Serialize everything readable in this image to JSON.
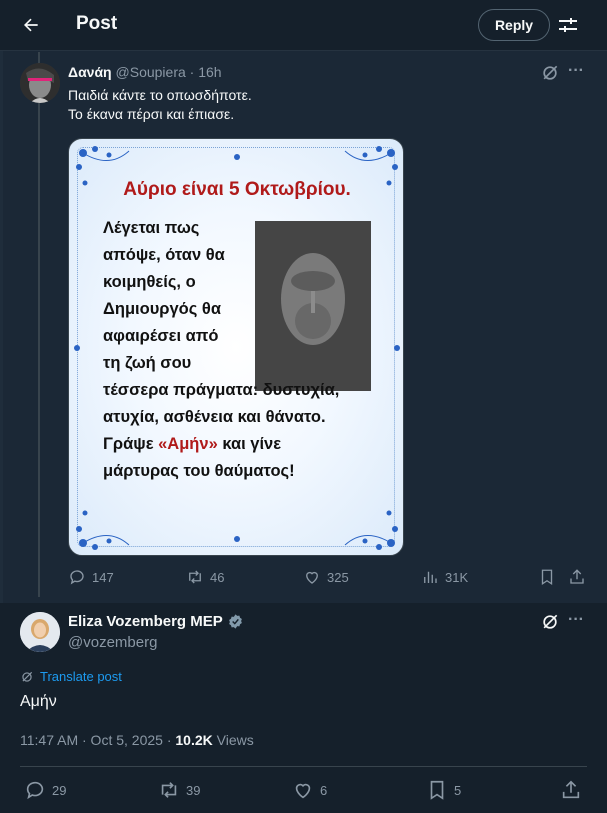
{
  "header": {
    "title": "Post",
    "reply_label": "Reply"
  },
  "parent_post": {
    "author_name": "Δανάη",
    "author_handle": "@Soupiera",
    "time": "· 16h",
    "text_lines": [
      "Παιδιά κάντε το οπωσδήποτε.",
      "Το έκανα πέρσι και έπιασε."
    ],
    "image": {
      "title": "Αύριο είναι 5 Οκτωβρίου.",
      "lines": [
        "Λέγεται πως",
        "απόψε, όταν θα",
        "κοιμηθείς, ο",
        "Δημιουργός θα",
        "αφαιρέσει από",
        "τη ζωή σου",
        "τέσσερα πράγματα: δυστυχία,",
        "ατυχία, ασθένεια και θάνατο."
      ],
      "line9_before": "Γράψε ",
      "line9_red": "«Αμήν»",
      "line9_after": " και γίνε",
      "line10": "μάρτυρας του θαύματος!"
    },
    "stats": {
      "replies": "147",
      "reposts": "46",
      "likes": "325",
      "views": "31K"
    }
  },
  "main_post": {
    "author_name": "Eliza Vozemberg MEP",
    "author_handle": "@vozemberg",
    "translate_label": "Translate post",
    "text": "Αμήν",
    "timestamp": "11:47 AM · Oct 5, 2025 · ",
    "views_count": "10.2K",
    "views_label": " Views",
    "stats": {
      "replies": "29",
      "reposts": "39",
      "likes": "6",
      "bookmarks": "5"
    }
  },
  "colors": {
    "background": "#15202b",
    "accent": "#1d9bf0",
    "muted": "#8b98a5",
    "title_red": "#b01a1a"
  }
}
